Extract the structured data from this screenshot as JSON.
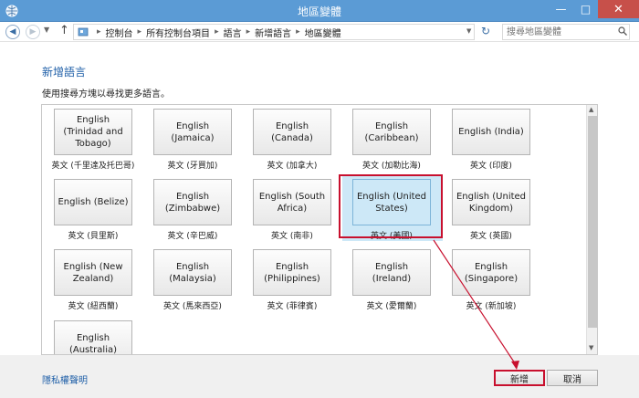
{
  "window": {
    "title": "地區變體"
  },
  "nav": {
    "breadcrumbs": [
      "控制台",
      "所有控制台項目",
      "語言",
      "新增語言",
      "地區變體"
    ],
    "search_placeholder": "搜尋地區變體"
  },
  "main": {
    "heading": "新增語言",
    "description": "使用搜尋方塊以尋找更多語言。"
  },
  "tiles": [
    {
      "name": "English (Trinidad and Tobago)",
      "sub": "英文 (千里達及托巴哥)"
    },
    {
      "name": "English (Jamaica)",
      "sub": "英文 (牙買加)"
    },
    {
      "name": "English (Canada)",
      "sub": "英文 (加拿大)"
    },
    {
      "name": "English (Caribbean)",
      "sub": "英文 (加勒比海)"
    },
    {
      "name": "English (India)",
      "sub": "英文 (印度)"
    },
    {
      "name": "English (Belize)",
      "sub": "英文 (貝里斯)"
    },
    {
      "name": "English (Zimbabwe)",
      "sub": "英文 (辛巴威)"
    },
    {
      "name": "English (South Africa)",
      "sub": "英文 (南非)"
    },
    {
      "name": "English (United States)",
      "sub": "英文 (美國)"
    },
    {
      "name": "English (United Kingdom)",
      "sub": "英文 (英國)"
    },
    {
      "name": "English (New Zealand)",
      "sub": "英文 (紐西蘭)"
    },
    {
      "name": "English (Malaysia)",
      "sub": "英文 (馬來西亞)"
    },
    {
      "name": "English (Philippines)",
      "sub": "英文 (菲律賓)"
    },
    {
      "name": "English (Ireland)",
      "sub": "英文 (愛爾蘭)"
    },
    {
      "name": "English (Singapore)",
      "sub": "英文 (新加坡)"
    },
    {
      "name": "English (Australia)",
      "sub": ""
    }
  ],
  "footer": {
    "privacy": "隱私權聲明",
    "add": "新增",
    "cancel": "取消"
  },
  "colors": {
    "titlebar": "#5b9bd5",
    "highlight": "#c8102e",
    "link": "#1f5fa8",
    "selection": "#cde8f7"
  },
  "icons": {
    "app": "language-globe-icon",
    "search": "search-icon"
  }
}
